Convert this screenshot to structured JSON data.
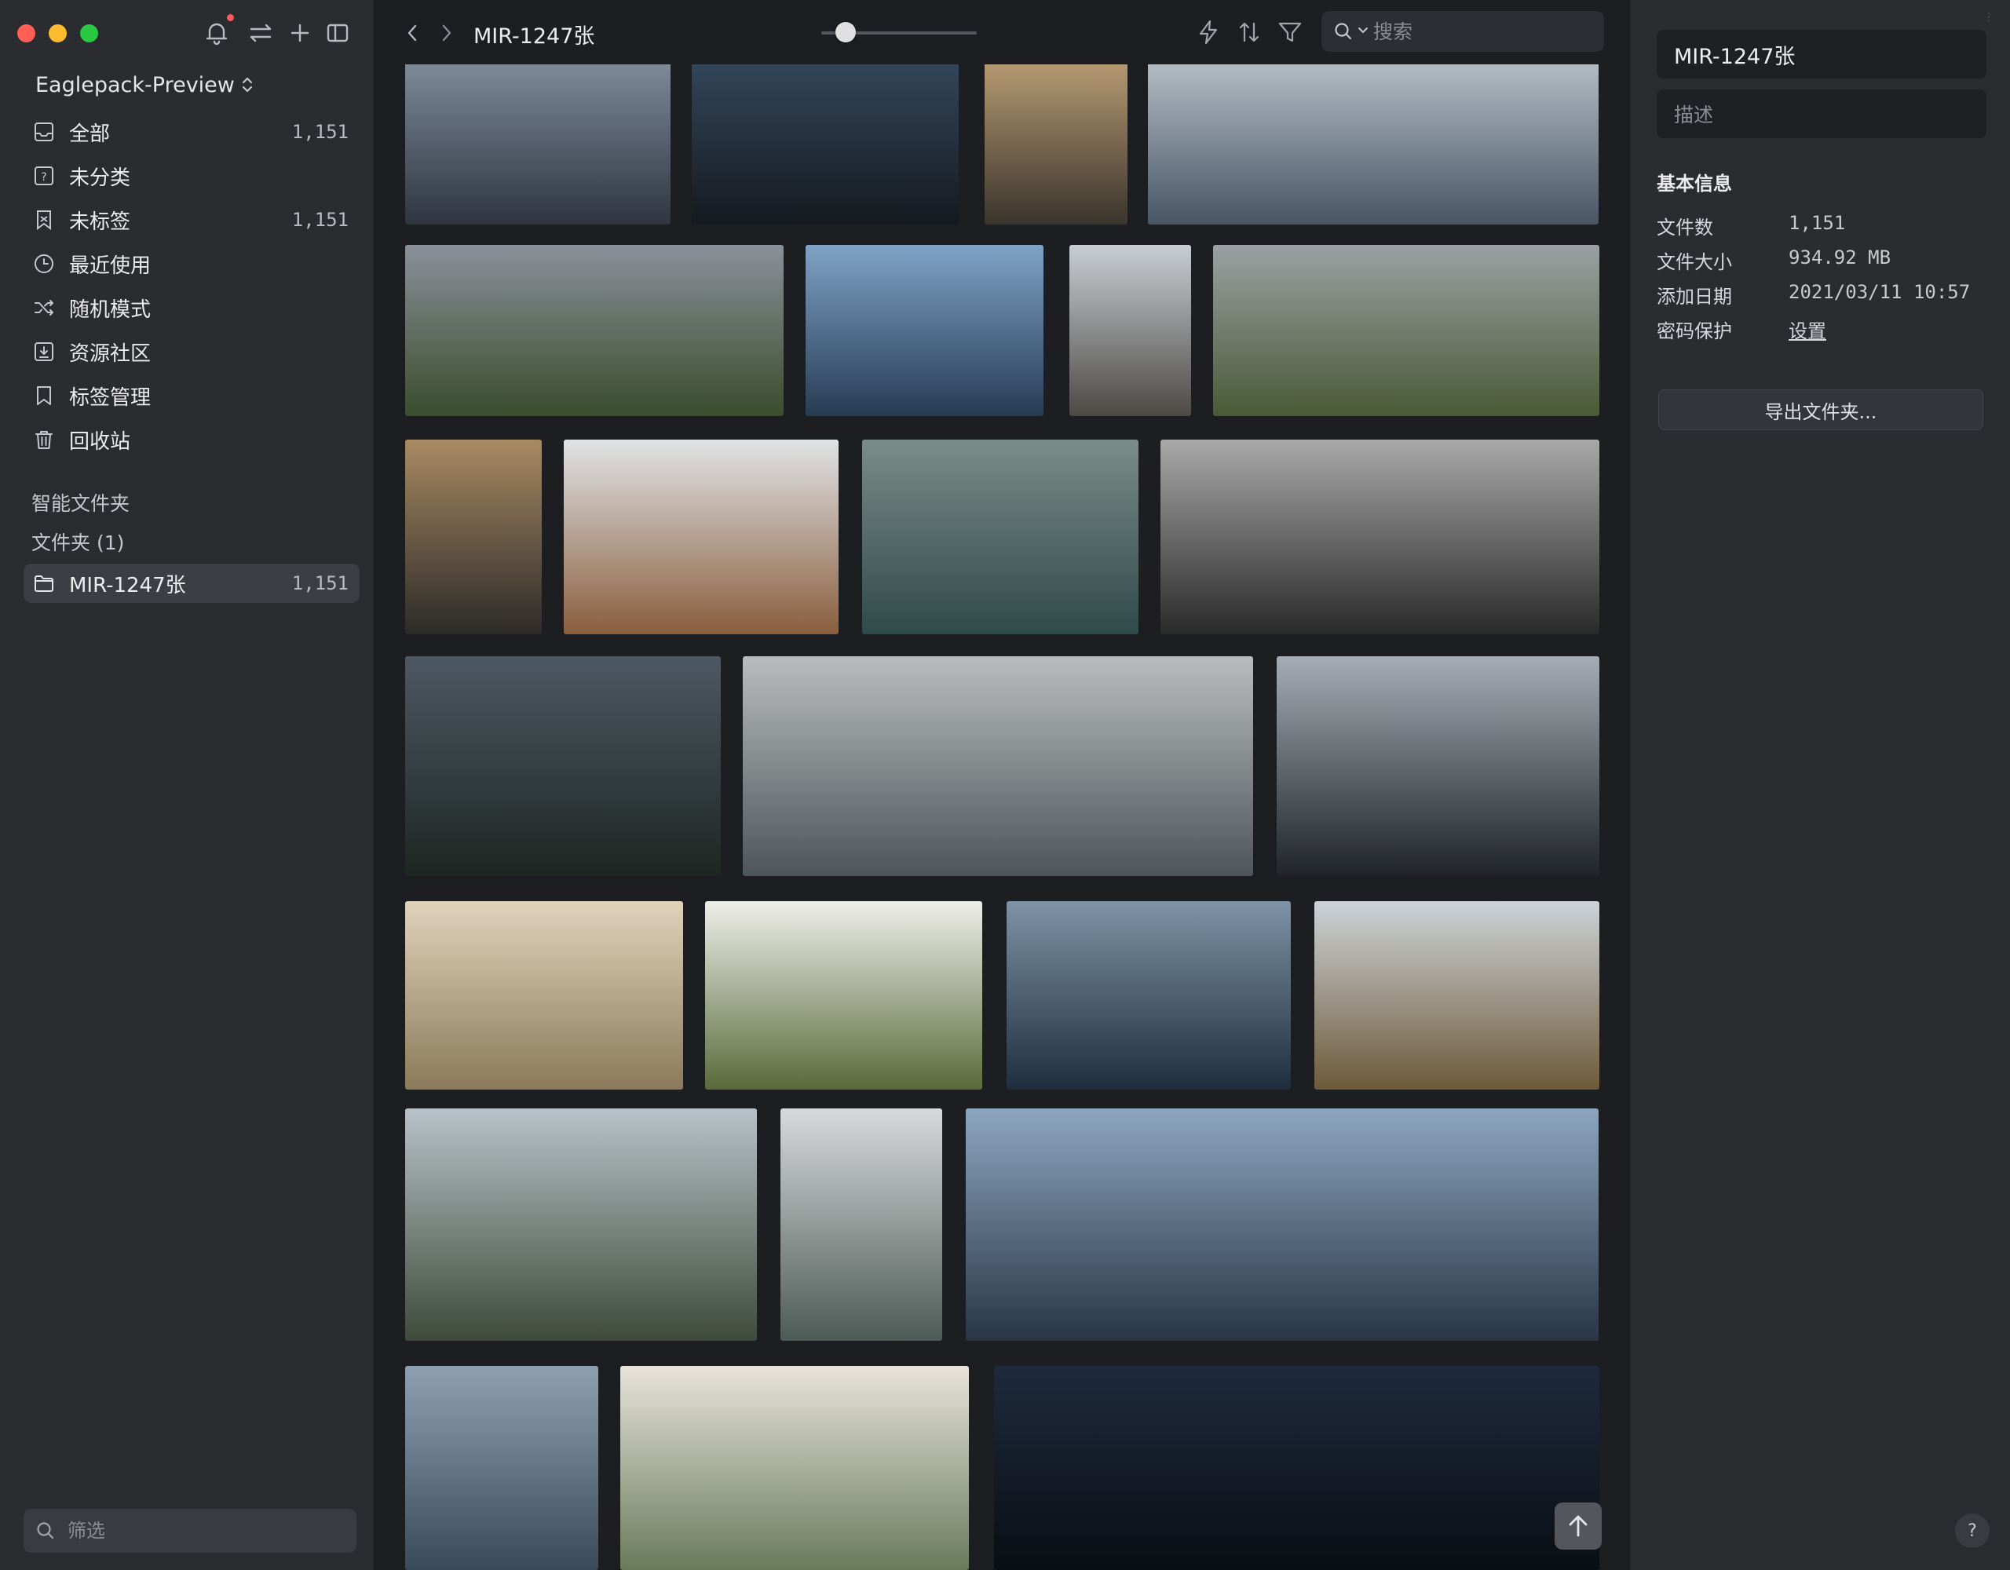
{
  "window": {
    "title": "MIR-1247张"
  },
  "sidebar": {
    "library_name": "Eaglepack-Preview",
    "nav_items": [
      {
        "label": "全部",
        "count": "1,151",
        "icon": "inbox-icon"
      },
      {
        "label": "未分类",
        "count": "",
        "icon": "unsorted-icon"
      },
      {
        "label": "未标签",
        "count": "1,151",
        "icon": "untagged-icon"
      },
      {
        "label": "最近使用",
        "count": "",
        "icon": "clock-icon"
      },
      {
        "label": "随机模式",
        "count": "",
        "icon": "shuffle-icon"
      },
      {
        "label": "资源社区",
        "count": "",
        "icon": "download-box-icon"
      },
      {
        "label": "标签管理",
        "count": "",
        "icon": "bookmark-icon"
      },
      {
        "label": "回收站",
        "count": "",
        "icon": "trash-icon"
      }
    ],
    "smart_folders_label": "智能文件夹",
    "folders_label": "文件夹 (1)",
    "folders": [
      {
        "label": "MIR-1247张",
        "count": "1,151",
        "selected": true
      }
    ],
    "filter_placeholder": "筛选"
  },
  "toolbar": {
    "title": "MIR-1247张",
    "search_placeholder": "搜索",
    "zoom_level": 0.1
  },
  "inspector": {
    "name_value": "MIR-1247张",
    "description_placeholder": "描述",
    "section_title": "基本信息",
    "rows": [
      {
        "key": "文件数",
        "value": "1,151",
        "link": false
      },
      {
        "key": "文件大小",
        "value": "934.92 MB",
        "link": false
      },
      {
        "key": "添加日期",
        "value": "2021/03/11 10:57",
        "link": false
      },
      {
        "key": "密码保护",
        "value": "设置",
        "link": true
      }
    ],
    "export_label": "导出文件夹..."
  },
  "help_label": "?",
  "colors": {
    "sidebar_bg": "#2b2c30",
    "content_bg": "#1d1e22",
    "selected_bg": "#3d3e43",
    "close": "#ff5f57",
    "minimize": "#febc2e",
    "maximize": "#28c840",
    "notification_dot": "#ff5a5f"
  },
  "thumbnails": [
    {
      "name": "thumb-bridge-night",
      "c1": "#7d8a9a",
      "c2": "#2e3540"
    },
    {
      "name": "thumb-towers-night",
      "c1": "#33465a",
      "c2": "#15191f"
    },
    {
      "name": "thumb-wood-facade",
      "c1": "#b59a72",
      "c2": "#3a342c"
    },
    {
      "name": "thumb-lake-building",
      "c1": "#b3bcc4",
      "c2": "#475565"
    },
    {
      "name": "thumb-curved-interior",
      "c1": "#8a909a",
      "c2": "#3a4d2c"
    },
    {
      "name": "thumb-glass-towers",
      "c1": "#7fa2c6",
      "c2": "#273c54"
    },
    {
      "name": "thumb-spire-street",
      "c1": "#c8cdd2",
      "c2": "#4d4a46"
    },
    {
      "name": "thumb-mountain-valley",
      "c1": "#9aa0a4",
      "c2": "#4a5a35"
    },
    {
      "name": "thumb-crowd-hall",
      "c1": "#a88a62",
      "c2": "#2c2a28"
    },
    {
      "name": "thumb-campus-aerial",
      "c1": "#e0e3e6",
      "c2": "#8a5e3e"
    },
    {
      "name": "thumb-wavy-towers",
      "c1": "#7a8c88",
      "c2": "#2f4a4a"
    },
    {
      "name": "thumb-bw-trees",
      "c1": "#a8a8a8",
      "c2": "#2a2a2a"
    },
    {
      "name": "thumb-dusk-houses",
      "c1": "#4d5863",
      "c2": "#1e2622"
    },
    {
      "name": "thumb-lake-house",
      "c1": "#b9bcbd",
      "c2": "#4e5559"
    },
    {
      "name": "thumb-pyramid-tower",
      "c1": "#a5acb4",
      "c2": "#202428"
    },
    {
      "name": "thumb-bright-hall",
      "c1": "#e0d2bb",
      "c2": "#8a7a5a"
    },
    {
      "name": "thumb-white-villas",
      "c1": "#eeeeea",
      "c2": "#5a6a3a"
    },
    {
      "name": "thumb-water-disc",
      "c1": "#7e93a6",
      "c2": "#1e2e3e"
    },
    {
      "name": "thumb-autumn-blocks",
      "c1": "#cdd3d8",
      "c2": "#6d5a3a"
    },
    {
      "name": "thumb-terrace-housing",
      "c1": "#b8c2c8",
      "c2": "#3e4a3a"
    },
    {
      "name": "thumb-aerial-wedge",
      "c1": "#d8dadb",
      "c2": "#4d5a55"
    },
    {
      "name": "thumb-stadium-dusk",
      "c1": "#8ca6c0",
      "c2": "#283646"
    },
    {
      "name": "thumb-harbor-town",
      "c1": "#8da0b2",
      "c2": "#3a4a5a"
    },
    {
      "name": "thumb-hillside-aerial",
      "c1": "#e8e4dc",
      "c2": "#6a7a5a"
    },
    {
      "name": "thumb-night-panorama",
      "c1": "#1e2a3c",
      "c2": "#0a0e14"
    }
  ]
}
